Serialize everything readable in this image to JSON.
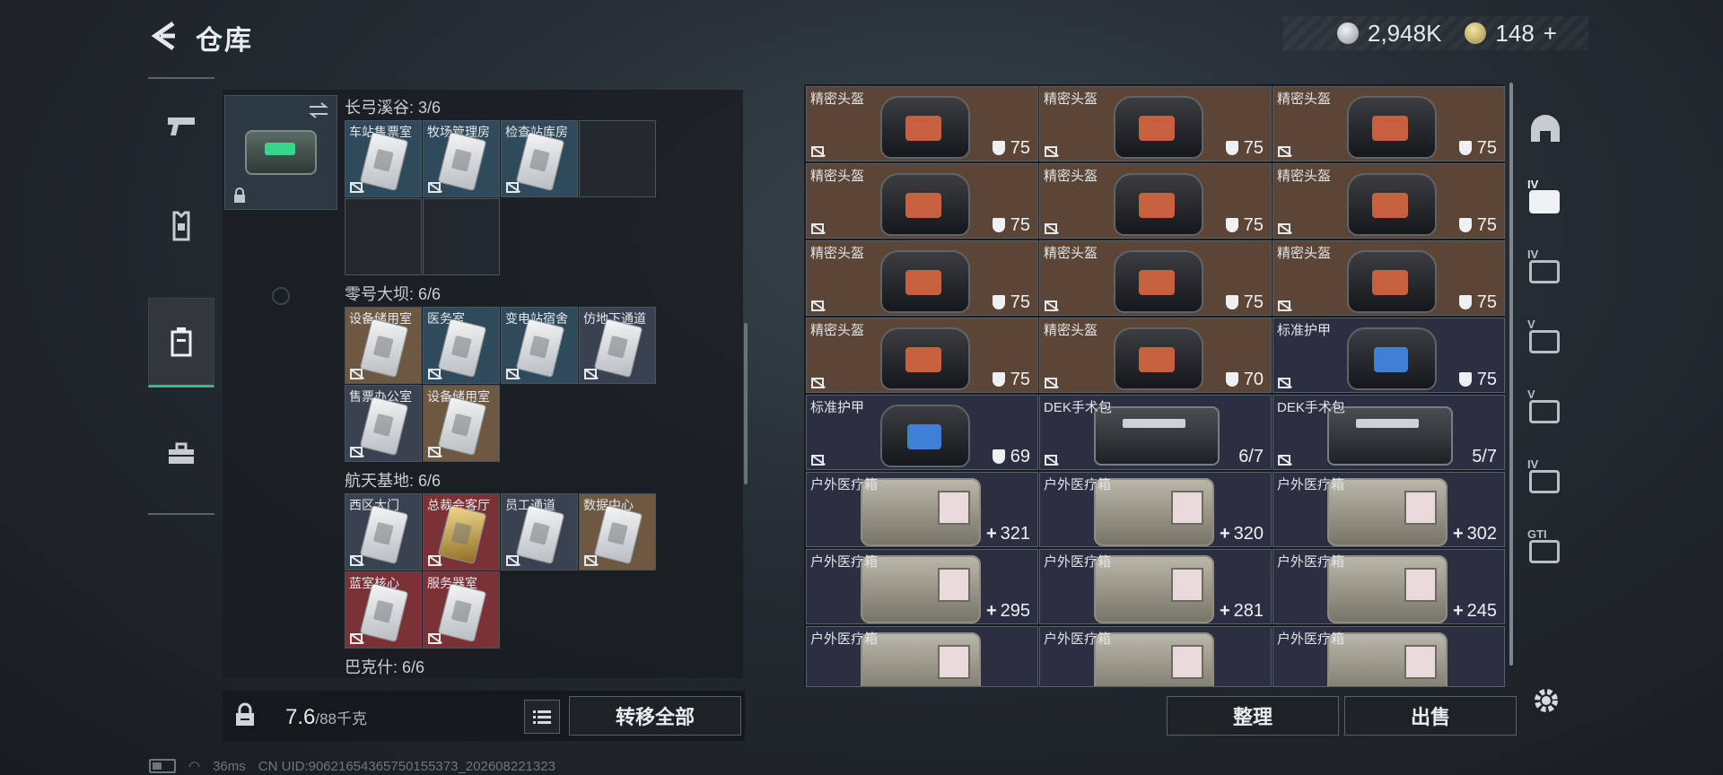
{
  "header": {
    "title": "仓库",
    "silver": "2,948K",
    "gold": "148",
    "gold_plus": "+"
  },
  "nav": [
    {
      "name": "weapon"
    },
    {
      "name": "armor-vest"
    },
    {
      "name": "container"
    },
    {
      "name": "toolbox"
    }
  ],
  "container": {
    "groups": [
      {
        "title": "长弓溪谷: 3/6",
        "slots": [
          {
            "label": "车站售票室",
            "color": "teal"
          },
          {
            "label": "牧场管理房",
            "color": "teal"
          },
          {
            "label": "检查站库房",
            "color": "teal"
          },
          {
            "label": "",
            "color": "empty"
          },
          {
            "label": "",
            "color": "empty"
          },
          {
            "label": "",
            "color": "empty"
          }
        ]
      },
      {
        "title": "零号大坝: 6/6",
        "slots": [
          {
            "label": "设备储用室",
            "color": "brown"
          },
          {
            "label": "医务室",
            "color": "teal"
          },
          {
            "label": "变电站宿舍",
            "color": "teal"
          },
          {
            "label": "仿地下通道",
            "color": "slate"
          },
          {
            "label": "售票办公室",
            "color": "slate"
          },
          {
            "label": "设备储用室",
            "color": "brown"
          }
        ]
      },
      {
        "title": "航天基地: 6/6",
        "slots": [
          {
            "label": "西区大门",
            "color": "slate"
          },
          {
            "label": "总裁会客厅",
            "color": "red",
            "gold": true
          },
          {
            "label": "员工通道",
            "color": "slate"
          },
          {
            "label": "数据中心",
            "color": "brown"
          },
          {
            "label": "蓝室核心",
            "color": "red"
          },
          {
            "label": "服务器室",
            "color": "red"
          }
        ]
      },
      {
        "title": "巴克什: 6/6",
        "slots": []
      }
    ]
  },
  "weight": {
    "value": "7.6",
    "capacity": "/88千克"
  },
  "buttons": {
    "transfer_all": "转移全部",
    "sort": "整理",
    "sell": "出售"
  },
  "warehouse": {
    "items": [
      {
        "name": "精密头盔",
        "type": "helmet",
        "value": "75",
        "stat": "shield",
        "bg": "brown"
      },
      {
        "name": "精密头盔",
        "type": "helmet",
        "value": "75",
        "stat": "shield",
        "bg": "brown"
      },
      {
        "name": "精密头盔",
        "type": "helmet",
        "value": "75",
        "stat": "shield",
        "bg": "brown"
      },
      {
        "name": "精密头盔",
        "type": "helmet",
        "value": "75",
        "stat": "shield",
        "bg": "brown"
      },
      {
        "name": "精密头盔",
        "type": "helmet",
        "value": "75",
        "stat": "shield",
        "bg": "brown"
      },
      {
        "name": "精密头盔",
        "type": "helmet",
        "value": "75",
        "stat": "shield",
        "bg": "brown"
      },
      {
        "name": "精密头盔",
        "type": "helmet",
        "value": "75",
        "stat": "shield",
        "bg": "brown"
      },
      {
        "name": "精密头盔",
        "type": "helmet",
        "value": "75",
        "stat": "shield",
        "bg": "brown"
      },
      {
        "name": "精密头盔",
        "type": "helmet",
        "value": "75",
        "stat": "shield",
        "bg": "brown"
      },
      {
        "name": "精密头盔",
        "type": "helmet",
        "value": "75",
        "stat": "shield",
        "bg": "brown"
      },
      {
        "name": "精密头盔",
        "type": "helmet",
        "value": "70",
        "stat": "shield",
        "bg": "brown"
      },
      {
        "name": "标准护甲",
        "type": "armor",
        "value": "75",
        "stat": "shield",
        "bg": "navy"
      },
      {
        "name": "标准护甲",
        "type": "armor",
        "value": "69",
        "stat": "shield",
        "bg": "navy"
      },
      {
        "name": "DEK手术包",
        "type": "surgkit",
        "value": "6/7",
        "stat": "none",
        "bg": "navy"
      },
      {
        "name": "DEK手术包",
        "type": "surgkit",
        "value": "5/7",
        "stat": "none",
        "bg": "navy"
      },
      {
        "name": "户外医疗箱",
        "type": "medkit",
        "value": "321",
        "stat": "plus",
        "bg": "navy"
      },
      {
        "name": "户外医疗箱",
        "type": "medkit",
        "value": "320",
        "stat": "plus",
        "bg": "navy"
      },
      {
        "name": "户外医疗箱",
        "type": "medkit",
        "value": "302",
        "stat": "plus",
        "bg": "navy"
      },
      {
        "name": "户外医疗箱",
        "type": "medkit",
        "value": "295",
        "stat": "plus",
        "bg": "navy"
      },
      {
        "name": "户外医疗箱",
        "type": "medkit",
        "value": "281",
        "stat": "plus",
        "bg": "navy"
      },
      {
        "name": "户外医疗箱",
        "type": "medkit",
        "value": "245",
        "stat": "plus",
        "bg": "navy"
      },
      {
        "name": "户外医疗箱",
        "type": "medkit",
        "value": "",
        "stat": "none",
        "bg": "navy"
      },
      {
        "name": "户外医疗箱",
        "type": "medkit",
        "value": "",
        "stat": "none",
        "bg": "navy"
      },
      {
        "name": "户外医疗箱",
        "type": "medkit",
        "value": "",
        "stat": "none",
        "bg": "navy"
      }
    ]
  },
  "right_sidebar": [
    {
      "name": "helmet-filter-icon",
      "tag": ""
    },
    {
      "name": "iv-medkit-add-icon",
      "tag": "IV"
    },
    {
      "name": "iv-medkit-icon",
      "tag": "IV"
    },
    {
      "name": "v-keycard-icon",
      "tag": "V"
    },
    {
      "name": "v-keycard-2-icon",
      "tag": "V"
    },
    {
      "name": "iv-keycard-icon",
      "tag": "IV"
    },
    {
      "name": "gti-keycard-icon",
      "tag": "GTI"
    }
  ],
  "status": {
    "latency": "36ms",
    "uid": "CN UID:9062165436575015537​3_202608221323"
  }
}
